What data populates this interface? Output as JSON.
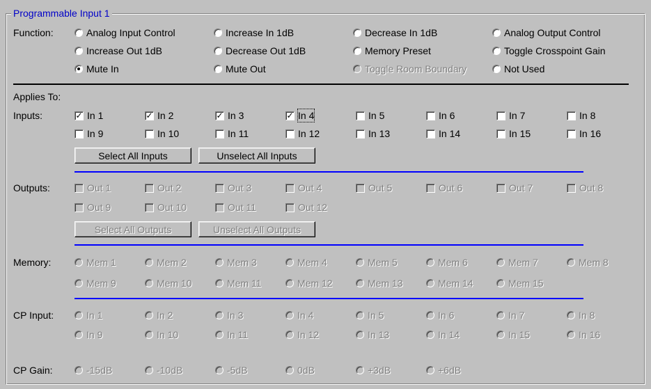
{
  "group_title": "Programmable Input 1",
  "function": {
    "label": "Function:",
    "options": [
      {
        "label": "Analog Input Control",
        "checked": false,
        "enabled": true
      },
      {
        "label": "Increase In 1dB",
        "checked": false,
        "enabled": true
      },
      {
        "label": "Decrease In 1dB",
        "checked": false,
        "enabled": true
      },
      {
        "label": "Analog Output Control",
        "checked": false,
        "enabled": true
      },
      {
        "label": "Increase Out 1dB",
        "checked": false,
        "enabled": true
      },
      {
        "label": "Decrease Out 1dB",
        "checked": false,
        "enabled": true
      },
      {
        "label": "Memory Preset",
        "checked": false,
        "enabled": true
      },
      {
        "label": "Toggle Crosspoint Gain",
        "checked": false,
        "enabled": true
      },
      {
        "label": "Mute In",
        "checked": true,
        "enabled": true
      },
      {
        "label": "Mute Out",
        "checked": false,
        "enabled": true
      },
      {
        "label": "Toggle Room Boundary",
        "checked": false,
        "enabled": false
      },
      {
        "label": "Not Used",
        "checked": false,
        "enabled": true
      }
    ]
  },
  "applies_to_label": "Applies To:",
  "inputs": {
    "label": "Inputs:",
    "items": [
      {
        "label": "In 1",
        "checked": true
      },
      {
        "label": "In 2",
        "checked": true
      },
      {
        "label": "In 3",
        "checked": true
      },
      {
        "label": "In 4",
        "checked": true
      },
      {
        "label": "In 5",
        "checked": false
      },
      {
        "label": "In 6",
        "checked": false
      },
      {
        "label": "In 7",
        "checked": false
      },
      {
        "label": "In 8",
        "checked": false
      },
      {
        "label": "In 9",
        "checked": false
      },
      {
        "label": "In 10",
        "checked": false
      },
      {
        "label": "In 11",
        "checked": false
      },
      {
        "label": "In 12",
        "checked": false
      },
      {
        "label": "In 13",
        "checked": false
      },
      {
        "label": "In 14",
        "checked": false
      },
      {
        "label": "In 15",
        "checked": false
      },
      {
        "label": "In 16",
        "checked": false
      }
    ],
    "select_all_label": "Select All Inputs",
    "unselect_all_label": "Unselect All Inputs"
  },
  "outputs": {
    "label": "Outputs:",
    "items": [
      "Out 1",
      "Out 2",
      "Out 3",
      "Out 4",
      "Out 5",
      "Out 6",
      "Out 7",
      "Out 8",
      "Out 9",
      "Out 10",
      "Out 11",
      "Out 12"
    ],
    "select_all_label": "Select All Outputs",
    "unselect_all_label": "Unselect All Outputs"
  },
  "memory": {
    "label": "Memory:",
    "items": [
      "Mem 1",
      "Mem 2",
      "Mem 3",
      "Mem 4",
      "Mem 5",
      "Mem 6",
      "Mem 7",
      "Mem 8",
      "Mem 9",
      "Mem 10",
      "Mem 11",
      "Mem 12",
      "Mem 13",
      "Mem 14",
      "Mem 15"
    ]
  },
  "cp_input": {
    "label": "CP Input:",
    "items": [
      "In 1",
      "In 2",
      "In 3",
      "In 4",
      "In 5",
      "In 6",
      "In 7",
      "In 8",
      "In 9",
      "In 10",
      "In 11",
      "In 12",
      "In 13",
      "In 14",
      "In 15",
      "In 16"
    ]
  },
  "cp_gain": {
    "label": "CP Gain:",
    "items": [
      "-15dB",
      "-10dB",
      "-5dB",
      "0dB",
      "+3dB",
      "+6dB"
    ]
  },
  "colors": {
    "group_title": "#0000c8",
    "separator_blue": "#0000ff",
    "background": "#c0c0c0"
  }
}
